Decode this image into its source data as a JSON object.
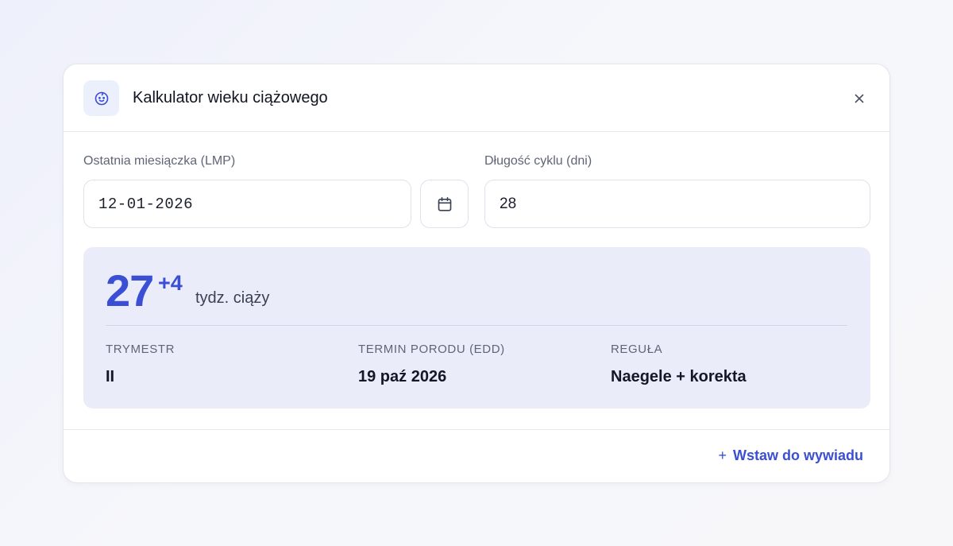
{
  "dialog": {
    "title": "Kalkulator wieku ciążowego",
    "icon": "baby-face-icon",
    "close_icon": "close-icon"
  },
  "form": {
    "lmp_label": "Ostatnia miesiączka (LMP)",
    "lmp_value": "12-01-2026",
    "calendar_icon": "calendar-icon",
    "cycle_label": "Długość cyklu (dni)",
    "cycle_value": "28"
  },
  "result": {
    "weeks": "27",
    "days": "+4",
    "unit": "tydz. ciąży",
    "stats": [
      {
        "label": "TRYMESTR",
        "value": "II"
      },
      {
        "label": "TERMIN PORODU (EDD)",
        "value": "19 paź 2026"
      },
      {
        "label": "REGUŁA",
        "value": "Naegele + korekta"
      }
    ]
  },
  "footer": {
    "insert_plus": "+",
    "insert_label": "Wstaw do wywiadu"
  },
  "colors": {
    "accent": "#3b4fd4",
    "result_bg": "#eaecfa",
    "icon_bg": "#eceffc"
  }
}
